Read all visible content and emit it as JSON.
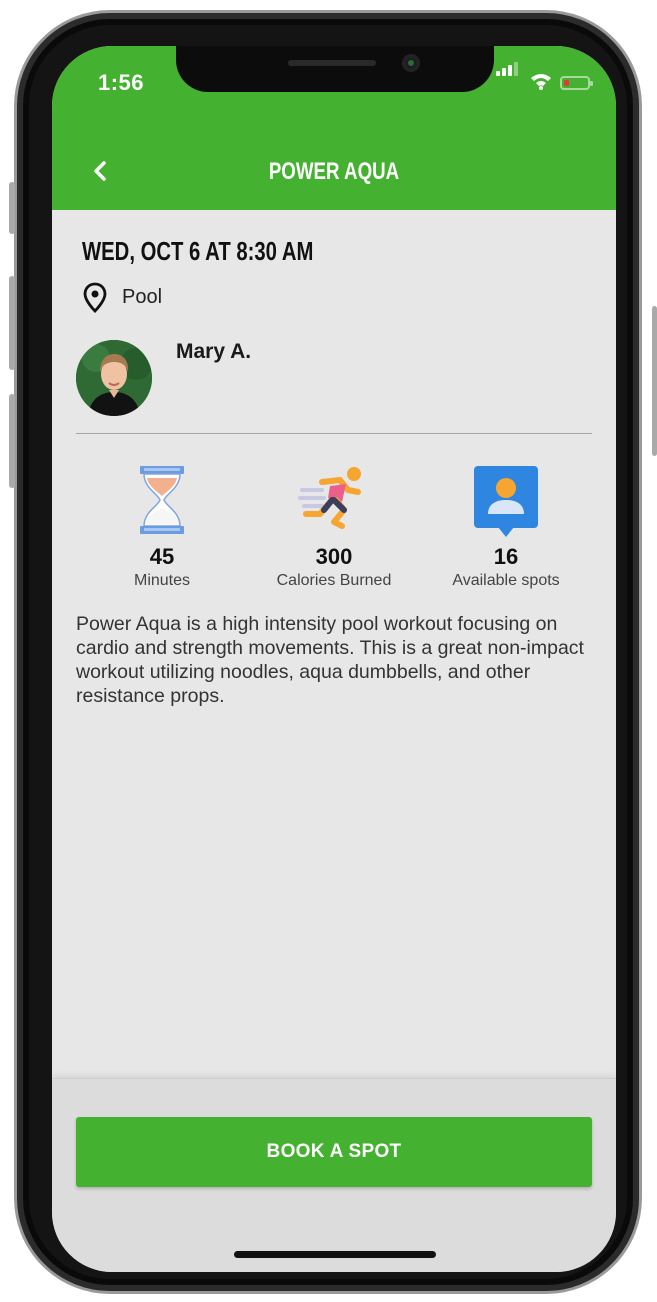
{
  "status_bar": {
    "time": "1:56"
  },
  "nav": {
    "title": "POWER AQUA",
    "back_icon": "chevron-left-icon"
  },
  "class": {
    "datetime": "WED, OCT 6 AT 8:30 AM",
    "location": "Pool",
    "trainer": "Mary A."
  },
  "stats": [
    {
      "value": "45",
      "label": "Minutes",
      "icon": "hourglass-icon"
    },
    {
      "value": "300",
      "label": "Calories Burned",
      "icon": "runner-icon"
    },
    {
      "value": "16",
      "label": "Available spots",
      "icon": "person-badge-icon"
    }
  ],
  "description": "Power Aqua is a high intensity pool workout focusing on cardio and strength movements.  This is a great non-impact workout utilizing noodles, aqua dumbbells, and other resistance props.",
  "actions": {
    "book_label": "BOOK A SPOT"
  },
  "colors": {
    "brand_green": "#45b130",
    "background": "#e7e7e7",
    "icon_blue": "#2f86e0"
  }
}
